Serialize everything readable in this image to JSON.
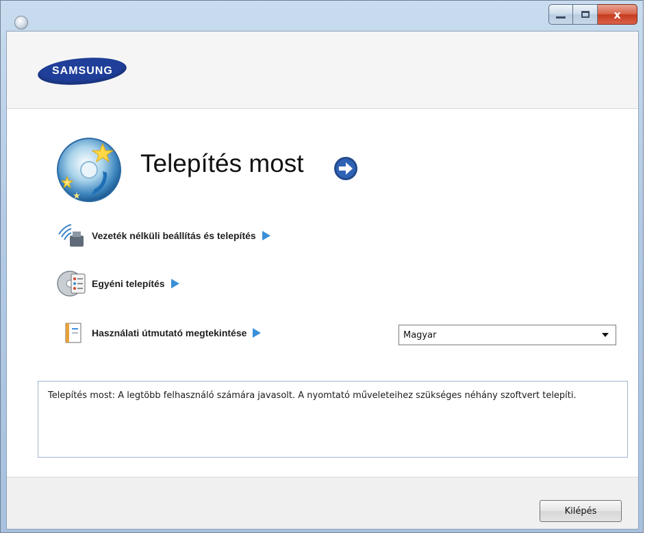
{
  "window": {
    "controls": {
      "minimize": "minimize-icon",
      "maximize": "maximize-icon",
      "close": "close-icon",
      "close_glyph": "x"
    }
  },
  "brand": {
    "logo_text": "SAMSUNG",
    "color": "#1f3f9a"
  },
  "hero": {
    "title": "Telepítés most",
    "icon": "install-disc-icon",
    "arrow_icon": "go-arrow-icon"
  },
  "options": [
    {
      "label": "Vezeték nélküli beállítás és telepítés",
      "icon": "wireless-icon"
    },
    {
      "label": "Egyéni telepítés",
      "icon": "custom-install-disc-icon"
    },
    {
      "label": "Használati útmutató megtekintése",
      "icon": "user-guide-icon"
    }
  ],
  "language_select": {
    "value": "Magyar"
  },
  "description": {
    "text": "Telepítés most: A legtöbb felhasználó számára javasolt. A nyomtató műveleteihez szükséges néhány szoftvert telepíti."
  },
  "footer": {
    "exit_label": "Kilépés"
  },
  "colors": {
    "accent_arrow": "#3a8fd8",
    "title_bar": "#b3cbe5"
  }
}
